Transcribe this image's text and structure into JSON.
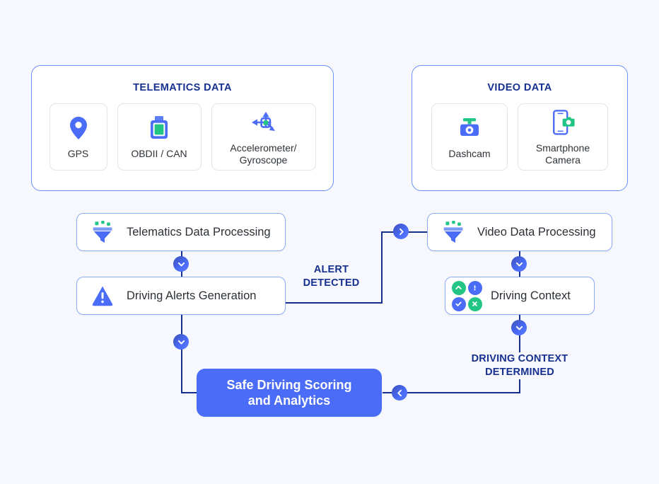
{
  "canvas": {
    "background": "#f6f8fd",
    "accent_blue": "#4a6cf7",
    "deep_blue": "#17308f",
    "green": "#22c583"
  },
  "panels": [
    {
      "title": "TELEMATICS DATA",
      "cards": [
        {
          "label": "GPS",
          "icon": "map-pin-icon"
        },
        {
          "label": "OBDII / CAN",
          "icon": "obd-connector-icon"
        },
        {
          "label": "Accelerometer/\nGyroscope",
          "icon": "accelerometer-icon"
        }
      ]
    },
    {
      "title": "VIDEO DATA",
      "cards": [
        {
          "label": "Dashcam",
          "icon": "dashcam-icon"
        },
        {
          "label": "Smartphone\nCamera",
          "icon": "smartphone-camera-icon"
        }
      ]
    }
  ],
  "nodes": {
    "telematics_processing": {
      "label": "Telematics Data Processing",
      "icon": "funnel-icon"
    },
    "driving_alerts": {
      "label": "Driving Alerts Generation",
      "icon": "alert-triangle-icon"
    },
    "video_processing": {
      "label": "Video Data Processing",
      "icon": "funnel-icon"
    },
    "driving_context": {
      "label": "Driving Context",
      "icon": "context-badges-icon"
    },
    "safe_driving": {
      "label": "Safe Driving Scoring\nand Analytics",
      "icon": "none"
    }
  },
  "flow_labels": {
    "alert_detected": "ALERT\nDETECTED",
    "context_determined": "DRIVING CONTEXT\nDETERMINED"
  },
  "connector_icons": {
    "down": "chevron-down-icon",
    "right": "chevron-right-icon",
    "left": "chevron-left-icon"
  }
}
